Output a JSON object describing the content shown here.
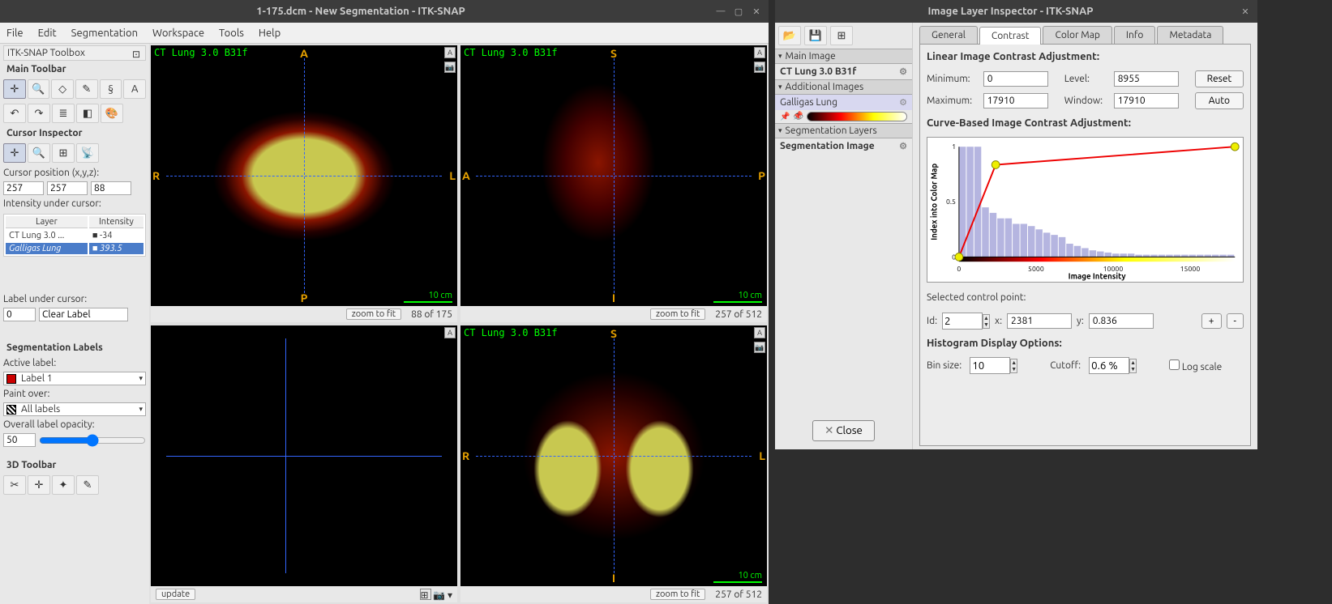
{
  "main_window": {
    "title": "1-175.dcm - New Segmentation - ITK-SNAP",
    "menubar": [
      "File",
      "Edit",
      "Segmentation",
      "Workspace",
      "Tools",
      "Help"
    ]
  },
  "toolbox": {
    "header": "ITK-SNAP Toolbox",
    "main_toolbar_label": "Main Toolbar",
    "cursor_inspector_label": "Cursor Inspector",
    "cursor_position_label": "Cursor position (x,y,z):",
    "cursor_x": "257",
    "cursor_y": "257",
    "cursor_z": "88",
    "intensity_label": "Intensity under cursor:",
    "intensity_headers": {
      "layer": "Layer",
      "intensity": "Intensity"
    },
    "intensity_rows": [
      {
        "layer": "CT Lung  3.0 ...",
        "value": "-34"
      },
      {
        "layer": "Galligas Lung",
        "value": "393.5"
      }
    ],
    "label_under_cursor_label": "Label under cursor:",
    "label_under_cursor_id": "0",
    "label_under_cursor_name": "Clear Label",
    "seg_labels_label": "Segmentation Labels",
    "active_label_label": "Active label:",
    "active_label_value": "Label 1",
    "paint_over_label": "Paint over:",
    "paint_over_value": "All labels",
    "opacity_label": "Overall label opacity:",
    "opacity_value": "50",
    "toolbar3d_label": "3D Toolbar"
  },
  "views": {
    "overlay_text": "CT Lung  3.0  B31f",
    "axial": {
      "top": "A",
      "bottom": "P",
      "left": "R",
      "right": "L",
      "scale": "10 cm",
      "zoom": "zoom to fit",
      "pos": "88 of 175"
    },
    "sagittal": {
      "top": "S",
      "bottom": "I",
      "left": "A",
      "right": "P",
      "scale": "10 cm",
      "zoom": "zoom to fit",
      "pos": "257 of 512"
    },
    "coronal": {
      "top": "S",
      "bottom": "I",
      "left": "R",
      "right": "L",
      "scale": "10 cm",
      "zoom": "zoom to fit",
      "pos": "257 of 512"
    },
    "update_btn": "update"
  },
  "inspector": {
    "title": "Image Layer Inspector - ITK-SNAP",
    "tabs": [
      "General",
      "Contrast",
      "Color Map",
      "Info",
      "Metadata"
    ],
    "active_tab": "Contrast",
    "main_image_hdr": "Main Image",
    "main_image_item": "CT Lung  3.0  B31f",
    "additional_hdr": "Additional Images",
    "additional_item": "Galligas Lung",
    "seg_hdr": "Segmentation Layers",
    "seg_item": "Segmentation Image",
    "close_btn": "Close",
    "linear_label": "Linear Image Contrast Adjustment:",
    "minimum_label": "Minimum:",
    "minimum_value": "0",
    "maximum_label": "Maximum:",
    "maximum_value": "17910",
    "level_label": "Level:",
    "level_value": "8955",
    "window_label": "Window:",
    "window_value": "17910",
    "reset_btn": "Reset",
    "auto_btn": "Auto",
    "curve_label": "Curve-Based Image Contrast Adjustment:",
    "selected_cp_label": "Selected control point:",
    "cp_id_label": "Id:",
    "cp_id": "2",
    "cp_x_label": "x:",
    "cp_x": "2381",
    "cp_y_label": "y:",
    "cp_y": "0.836",
    "plus": "+",
    "minus": "-",
    "hist_label": "Histogram Display Options:",
    "bin_label": "Bin size:",
    "bin_value": "10",
    "cutoff_label": "Cutoff:",
    "cutoff_value": "0.6 %",
    "log_label": "Log scale"
  },
  "chart_data": {
    "type": "line",
    "title": "",
    "xlabel": "Image Intensity",
    "ylabel": "Index into Color Map",
    "xlim": [
      0,
      17910
    ],
    "ylim": [
      0,
      1
    ],
    "xticks": [
      0,
      5000,
      10000,
      15000
    ],
    "yticks": [
      0,
      0.5,
      1
    ],
    "series": [
      {
        "name": "curve",
        "x": [
          0,
          2381,
          17910
        ],
        "y": [
          0,
          0.836,
          1
        ]
      }
    ],
    "control_points": [
      {
        "id": 1,
        "x": 0,
        "y": 0
      },
      {
        "id": 2,
        "x": 2381,
        "y": 0.836
      },
      {
        "id": 3,
        "x": 17910,
        "y": 1
      }
    ],
    "histogram": {
      "bin_size": 10,
      "approx_counts": [
        1.0,
        1.0,
        1.0,
        0.45,
        0.4,
        0.35,
        0.35,
        0.3,
        0.3,
        0.28,
        0.25,
        0.22,
        0.2,
        0.18,
        0.12,
        0.1,
        0.08,
        0.06,
        0.05,
        0.04,
        0.03,
        0.03,
        0.03,
        0.02,
        0.02,
        0.02,
        0.02,
        0.02,
        0.02,
        0.02,
        0.02,
        0.02,
        0.02,
        0.02,
        0.02,
        0.02
      ]
    }
  }
}
